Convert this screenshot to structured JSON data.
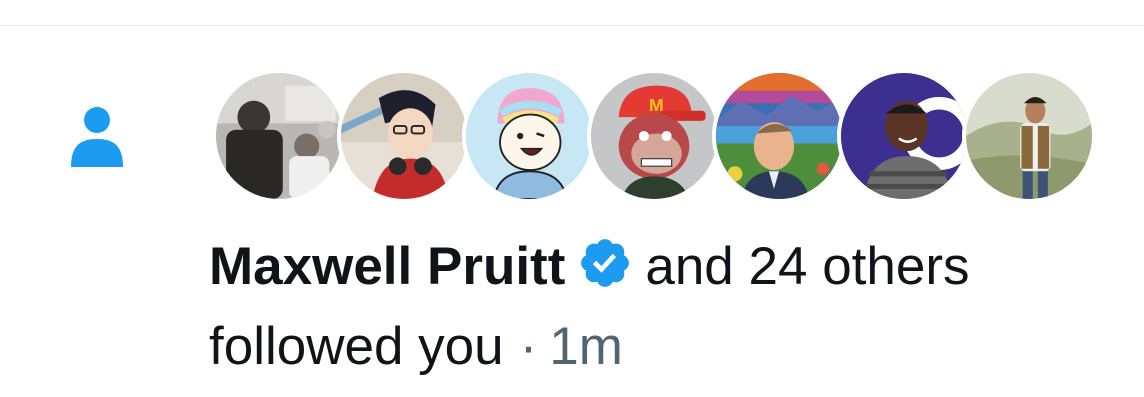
{
  "notification": {
    "icon": "person-icon",
    "accent_color": "#1d9bf0",
    "name": "Maxwell Pruitt",
    "verified_icon": "verified-badge-icon",
    "others_text": "and 24 others",
    "action_text": "followed you",
    "separator": "·",
    "timestamp": "1m"
  },
  "avatars": [
    {
      "icon": "avatar-photo-group"
    },
    {
      "icon": "avatar-anime-boy"
    },
    {
      "icon": "avatar-rainbow-hair-cartoon"
    },
    {
      "icon": "avatar-ape-red-cap"
    },
    {
      "icon": "avatar-man-painted-landscape"
    },
    {
      "icon": "avatar-man-purple-background"
    },
    {
      "icon": "avatar-man-outdoor-vest"
    }
  ]
}
